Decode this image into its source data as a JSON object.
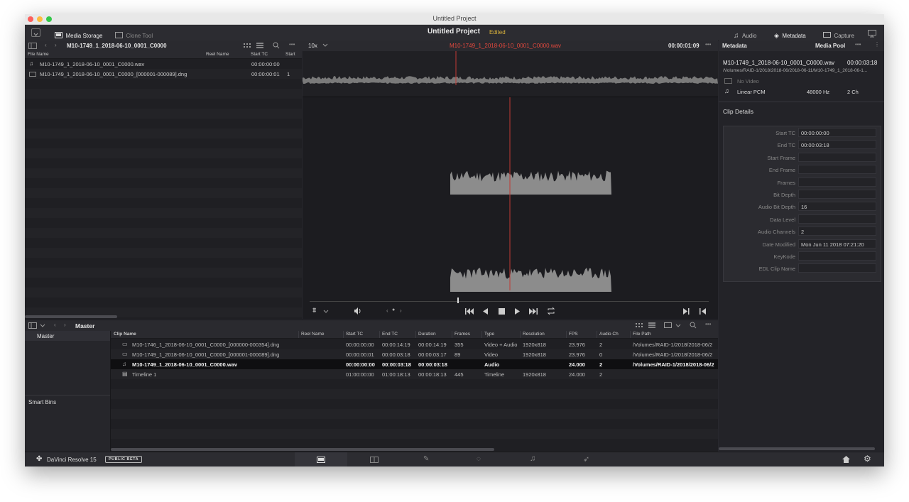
{
  "window": {
    "title": "Untitled Project"
  },
  "topbar": {
    "media_storage": "Media Storage",
    "clone_tool": "Clone Tool",
    "project_name": "Untitled Project",
    "edited": "Edited",
    "audio": "Audio",
    "metadata": "Metadata",
    "capture": "Capture"
  },
  "browser": {
    "path": "M10-1749_1_2018-06-10_0001_C0000",
    "columns": [
      "File Name",
      "Reel Name",
      "Start TC",
      "Start"
    ],
    "files": [
      {
        "name": "M10-1749_1_2018-06-10_0001_C0000.wav",
        "reel": "",
        "start_tc": "00:00:00:00",
        "start": "",
        "icon": "music-note-icon"
      },
      {
        "name": "M10-1749_1_2018-06-10_0001_C0000_[000001-000089].dng",
        "reel": "",
        "start_tc": "00:00:00:01",
        "start": "1",
        "icon": "video-clip-icon"
      }
    ]
  },
  "viewer": {
    "zoom": "10x",
    "clip_name": "M10-1749_1_2018-06-10_0001_C0000.wav",
    "timecode": "00:00:01:09"
  },
  "pool": {
    "master": "Master",
    "bins": [
      "Master"
    ],
    "smart_bins": "Smart Bins",
    "columns": [
      "Clip Name",
      "Reel Name",
      "Start TC",
      "End TC",
      "Duration",
      "Frames",
      "Type",
      "Resolution",
      "FPS",
      "Audio Ch",
      "File Path"
    ],
    "rows": [
      {
        "name": "M10-1746_1_2018-06-10_0001_C0000_[000000-000354].dng",
        "reel": "",
        "start": "00:00:00:00",
        "end": "00:00:14:19",
        "dur": "00:00:14:19",
        "frames": "355",
        "type": "Video + Audio",
        "res": "1920x818",
        "fps": "23.976",
        "ach": "2",
        "path": "/Volumes/RAID-1/2018/2018-06/2",
        "icon": "video-clip-icon",
        "selected": false
      },
      {
        "name": "M10-1749_1_2018-06-10_0001_C0000_[000001-000089].dng",
        "reel": "",
        "start": "00:00:00:01",
        "end": "00:00:03:18",
        "dur": "00:00:03:17",
        "frames": "89",
        "type": "Video",
        "res": "1920x818",
        "fps": "23.976",
        "ach": "0",
        "path": "/Volumes/RAID-1/2018/2018-06/2",
        "icon": "video-clip-icon",
        "selected": false
      },
      {
        "name": "M10-1749_1_2018-06-10_0001_C0000.wav",
        "reel": "",
        "start": "00:00:00:00",
        "end": "00:00:03:18",
        "dur": "00:00:03:18",
        "frames": "",
        "type": "Audio",
        "res": "",
        "fps": "24.000",
        "ach": "2",
        "path": "/Volumes/RAID-1/2018/2018-06/2",
        "icon": "music-note-icon",
        "selected": true
      },
      {
        "name": "Timeline 1",
        "reel": "",
        "start": "01:00:00:00",
        "end": "01:00:18:13",
        "dur": "00:00:18:13",
        "frames": "445",
        "type": "Timeline",
        "res": "1920x818",
        "fps": "24.000",
        "ach": "2",
        "path": "",
        "icon": "timeline-icon",
        "selected": false
      }
    ]
  },
  "metadata": {
    "title": "Metadata",
    "pool_label": "Media Pool",
    "clip_name": "M10-1749_1_2018-06-10_0001_C0000.wav",
    "clip_duration": "00:00:03:18",
    "clip_path": "/Volumes/RAID-1/2018/2018-06/2018-06-11/M10-1749_1_2018-06-1...",
    "no_video": "No Video",
    "codec": "Linear PCM",
    "sample_rate": "48000 Hz",
    "channels": "2 Ch",
    "section": "Clip Details",
    "fields": [
      {
        "label": "Start TC",
        "value": "00:00:00:00"
      },
      {
        "label": "End TC",
        "value": "00:00:03:18"
      },
      {
        "label": "Start Frame",
        "value": ""
      },
      {
        "label": "End Frame",
        "value": ""
      },
      {
        "label": "Frames",
        "value": ""
      },
      {
        "label": "Bit Depth",
        "value": ""
      },
      {
        "label": "Audio Bit Depth",
        "value": "16"
      },
      {
        "label": "Data Level",
        "value": ""
      },
      {
        "label": "Audio Channels",
        "value": "2"
      },
      {
        "label": "Date Modified",
        "value": "Mon Jun 11 2018 07:21:20"
      },
      {
        "label": "KeyKode",
        "value": ""
      },
      {
        "label": "EDL Clip Name",
        "value": ""
      }
    ]
  },
  "footer": {
    "app": "DaVinci Resolve 15",
    "badge": "PUBLIC BETA"
  },
  "colors": {
    "accent_red": "#e2483d",
    "edited_yellow": "#d8b13c",
    "playhead": "#c23a34"
  }
}
